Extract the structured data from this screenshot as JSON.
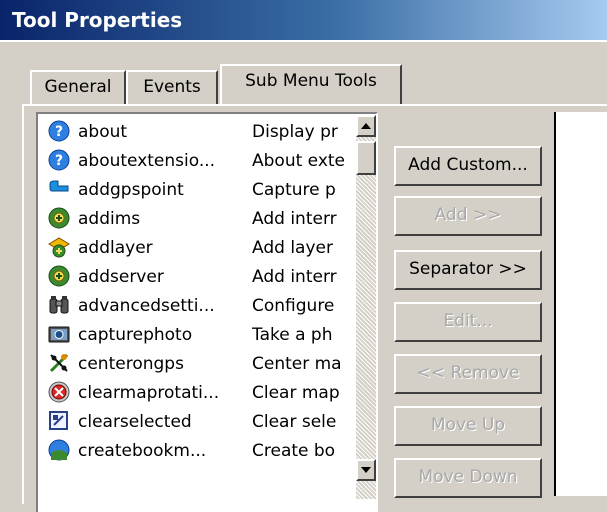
{
  "window": {
    "title": "Tool Properties"
  },
  "tabs": [
    {
      "label": "General"
    },
    {
      "label": "Events"
    },
    {
      "label": "Sub Menu Tools"
    }
  ],
  "list": {
    "items": [
      {
        "name": "about",
        "description": "Display pr",
        "icon": "help-icon"
      },
      {
        "name": "aboutextensio...",
        "description": "About exte",
        "icon": "help-icon"
      },
      {
        "name": "addgpspoint",
        "description": "Capture p",
        "icon": "gps-point-icon"
      },
      {
        "name": "addims",
        "description": "Add interr",
        "icon": "add-ims-icon"
      },
      {
        "name": "addlayer",
        "description": "Add layer",
        "icon": "add-layer-icon"
      },
      {
        "name": "addserver",
        "description": "Add interr",
        "icon": "add-server-icon"
      },
      {
        "name": "advancedsetti...",
        "description": "Configure",
        "icon": "binoculars-icon"
      },
      {
        "name": "capturephoto",
        "description": "Take a ph",
        "icon": "camera-icon"
      },
      {
        "name": "centerongps",
        "description": "Center ma",
        "icon": "center-gps-icon"
      },
      {
        "name": "clearmaprotati...",
        "description": "Clear map",
        "icon": "clear-rotation-icon"
      },
      {
        "name": "clearselected",
        "description": "Clear sele",
        "icon": "clear-selected-icon"
      },
      {
        "name": "createbookm...",
        "description": "Create bo",
        "icon": "bookmark-icon"
      }
    ]
  },
  "buttons": {
    "add_custom": "Add Custom...",
    "add": "Add >>",
    "separator": "Separator >>",
    "edit": "Edit...",
    "remove": "<< Remove",
    "move_up": "Move Up",
    "move_down": "Move Down"
  }
}
